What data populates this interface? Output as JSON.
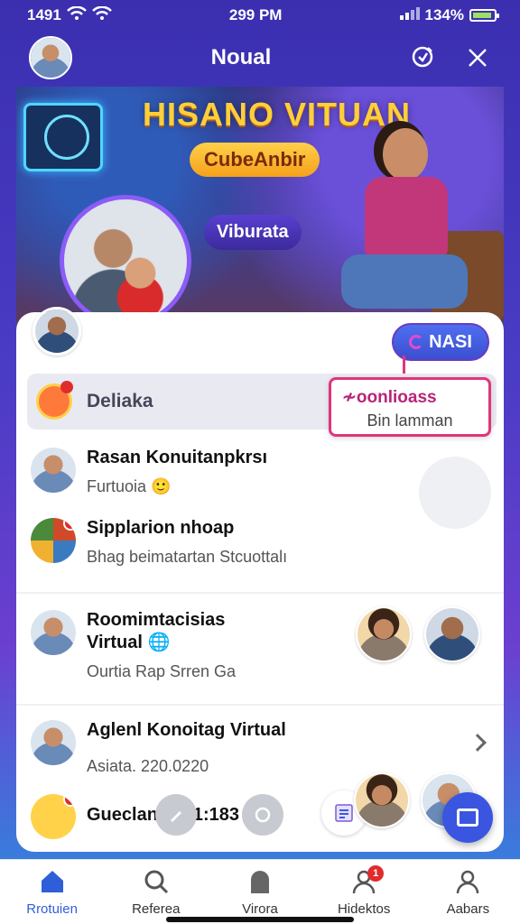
{
  "status": {
    "time_left": "1491",
    "time_center": "299 PM",
    "battery": "134%"
  },
  "header": {
    "title": "Noual"
  },
  "banner": {
    "title": "HISANO VITUAN",
    "chip1": "CubeAnbir",
    "chip2": "Viburata"
  },
  "actions": {
    "next_label": "NASI"
  },
  "search": {
    "label": "Deliaka"
  },
  "tooltip": {
    "title": "≁oonlioass",
    "subtitle": "Bin lamman"
  },
  "rows": [
    {
      "name": "Rasan Konuitanpkrsı",
      "sub": "Furtuoia"
    },
    {
      "name": "Sipplarion nhoap",
      "sub": "Bhag beimatartan Stcuottalı"
    },
    {
      "name": "Roomimtacisias",
      "name2": "Virtual",
      "sub": "Ourtia Rap Srren Ga"
    },
    {
      "name": "Aglenl Konoitag Virtual",
      "sub": "Asiata. 220.0220"
    },
    {
      "name": "Gueclan 2__1:183",
      "sub": ""
    }
  ],
  "tabs": [
    {
      "label": "Rrotuien",
      "icon": "home-icon",
      "active": true
    },
    {
      "label": "Referea",
      "icon": "search-icon",
      "active": false
    },
    {
      "label": "Virora",
      "icon": "ghost-icon",
      "active": false
    },
    {
      "label": "Hidektos",
      "icon": "user-icon",
      "active": false,
      "badge": "1"
    },
    {
      "label": "Aabars",
      "icon": "profile-icon",
      "active": false
    }
  ],
  "colors": {
    "accent": "#3a56e0",
    "header_bg": "#3b2fb0",
    "tooltip_border": "#e0357c"
  }
}
